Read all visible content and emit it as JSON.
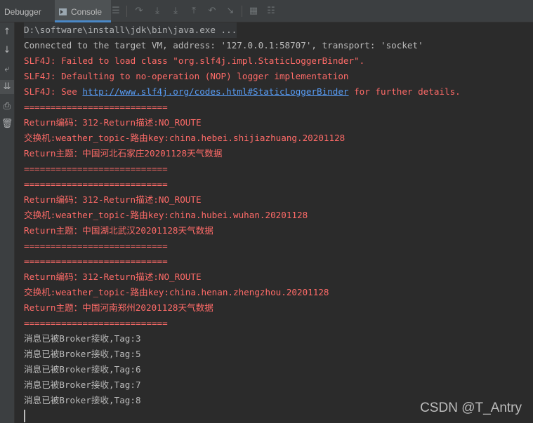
{
  "tabs": {
    "debugger": "Debugger",
    "console": "Console"
  },
  "toolbar_icons": [
    "menu-icon",
    "step-over-icon",
    "step-into-icon",
    "force-step-into-icon",
    "step-out-icon",
    "drop-frame-icon",
    "run-to-cursor-icon",
    "evaluate-icon",
    "trace-icon"
  ],
  "gutter_icons": [
    "up-arrow-icon",
    "down-arrow-icon",
    "soft-wrap-icon",
    "scroll-to-end-icon",
    "print-icon",
    "trash-icon"
  ],
  "console": {
    "command": "D:\\software\\install\\jdk\\bin\\java.exe ...",
    "connected": "Connected to the target VM, address: '127.0.0.1:58707', transport: 'socket'",
    "slf4j_1": "SLF4J: Failed to load class \"org.slf4j.impl.StaticLoggerBinder\".",
    "slf4j_2": "SLF4J: Defaulting to no-operation (NOP) logger implementation",
    "slf4j_3_prefix": "SLF4J: See ",
    "slf4j_3_link": "http://www.slf4j.org/codes.html#StaticLoggerBinder",
    "slf4j_3_suffix": " for further details.",
    "sep": "===========================",
    "b1_code": "Return编码：312-Return描述:NO_ROUTE",
    "b1_exchange": "交换机:weather_topic-路由key:china.hebei.shijiazhuang.20201128",
    "b1_subject": "Return主题：中国河北石家庄20201128天气数据",
    "b2_code": "Return编码：312-Return描述:NO_ROUTE",
    "b2_exchange": "交换机:weather_topic-路由key:china.hubei.wuhan.20201128",
    "b2_subject": "Return主题：中国湖北武汉20201128天气数据",
    "b3_code": "Return编码：312-Return描述:NO_ROUTE",
    "b3_exchange": "交换机:weather_topic-路由key:china.henan.zhengzhou.20201128",
    "b3_subject": "Return主题：中国河南郑州20201128天气数据",
    "ack_3": "消息已被Broker接收,Tag:3",
    "ack_5": "消息已被Broker接收,Tag:5",
    "ack_6": "消息已被Broker接收,Tag:6",
    "ack_7": "消息已被Broker接收,Tag:7",
    "ack_8": "消息已被Broker接收,Tag:8"
  },
  "watermark": "CSDN @T_Antry"
}
